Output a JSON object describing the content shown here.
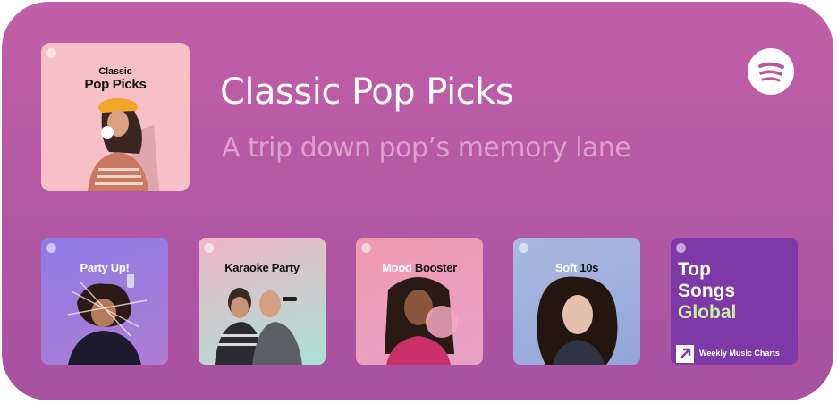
{
  "widget": {
    "background": "#b359a4",
    "hero": {
      "cover_line1": "Classic",
      "cover_line2": "Pop Picks",
      "title": "Classic Pop Picks",
      "subtitle": "A trip down pop’s memory lane"
    },
    "spotify_icon": "spotify-logo-icon",
    "tiles": [
      {
        "label_main": "Party Up!",
        "label_accent": "",
        "accent_color": "#ffffff"
      },
      {
        "label_main": "Karaoke Party",
        "label_accent": "",
        "accent_color": "#111111"
      },
      {
        "label_main": "Mood ",
        "label_accent": "Booster",
        "accent_color": "#111111"
      },
      {
        "label_main": "Soft ",
        "label_accent": "10s",
        "accent_color": "#111111"
      },
      {
        "line1": "Top",
        "line2": "Songs",
        "line3": "Global",
        "footer": "Weekly Music Charts",
        "accent_color": "#c7f0a7"
      }
    ]
  }
}
